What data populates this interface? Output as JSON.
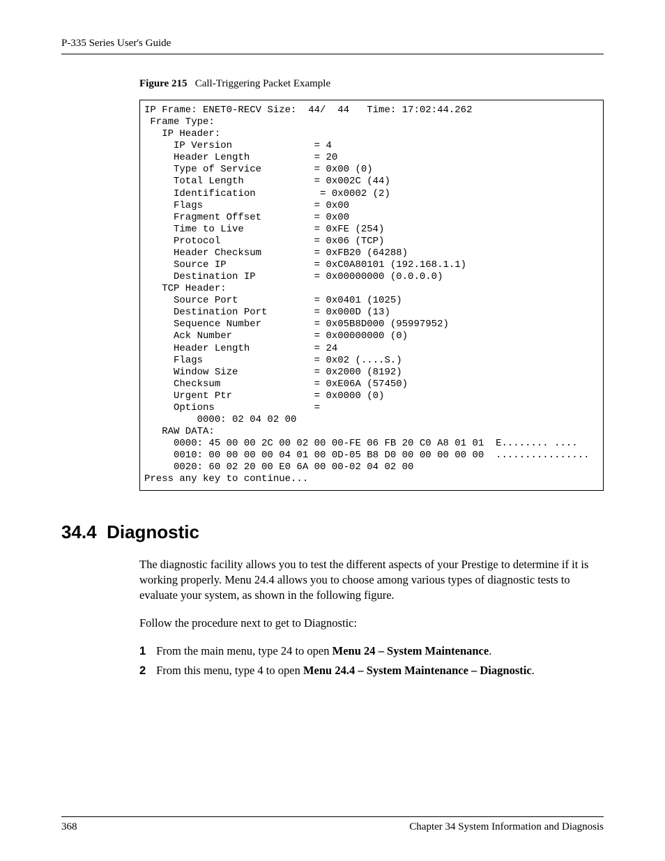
{
  "header": {
    "title": "P-335 Series User's Guide"
  },
  "figure": {
    "label": "Figure 215",
    "caption": "Call-Triggering Packet Example",
    "code": "IP Frame: ENET0-RECV Size:  44/  44   Time: 17:02:44.262\n Frame Type:\n   IP Header:\n     IP Version              = 4\n     Header Length           = 20\n     Type of Service         = 0x00 (0)\n     Total Length            = 0x002C (44)\n     Identification           = 0x0002 (2)\n     Flags                   = 0x00\n     Fragment Offset         = 0x00\n     Time to Live            = 0xFE (254)\n     Protocol                = 0x06 (TCP)\n     Header Checksum         = 0xFB20 (64288)\n     Source IP               = 0xC0A80101 (192.168.1.1)\n     Destination IP          = 0x00000000 (0.0.0.0)\n   TCP Header:\n     Source Port             = 0x0401 (1025)\n     Destination Port        = 0x000D (13)\n     Sequence Number         = 0x05B8D000 (95997952)\n     Ack Number              = 0x00000000 (0)\n     Header Length           = 24\n     Flags                   = 0x02 (....S.)\n     Window Size             = 0x2000 (8192)\n     Checksum                = 0xE06A (57450)\n     Urgent Ptr              = 0x0000 (0)\n     Options                 =\n         0000: 02 04 02 00\n   RAW DATA:\n     0000: 45 00 00 2C 00 02 00 00-FE 06 FB 20 C0 A8 01 01  E........ ....\n     0010: 00 00 00 00 04 01 00 0D-05 B8 D0 00 00 00 00 00  ................\n     0020: 60 02 20 00 E0 6A 00 00-02 04 02 00\nPress any key to continue..."
  },
  "section": {
    "number": "34.4",
    "title": "Diagnostic",
    "para1": "The diagnostic facility allows you to test the different aspects of your Prestige to determine if it is working properly. Menu 24.4 allows you to choose among various types of diagnostic tests to evaluate your system, as shown in the following figure.",
    "para2": "Follow the procedure next to get to Diagnostic:",
    "steps": [
      {
        "num": "1",
        "before": "From the main menu, type 24 to open ",
        "bold": "Menu 24 – System Maintenance",
        "after": "."
      },
      {
        "num": "2",
        "before": "From this menu, type 4 to open ",
        "bold": "Menu 24.4 – System Maintenance – Diagnostic",
        "after": "."
      }
    ]
  },
  "footer": {
    "page": "368",
    "chapter": "Chapter 34 System Information and Diagnosis"
  }
}
